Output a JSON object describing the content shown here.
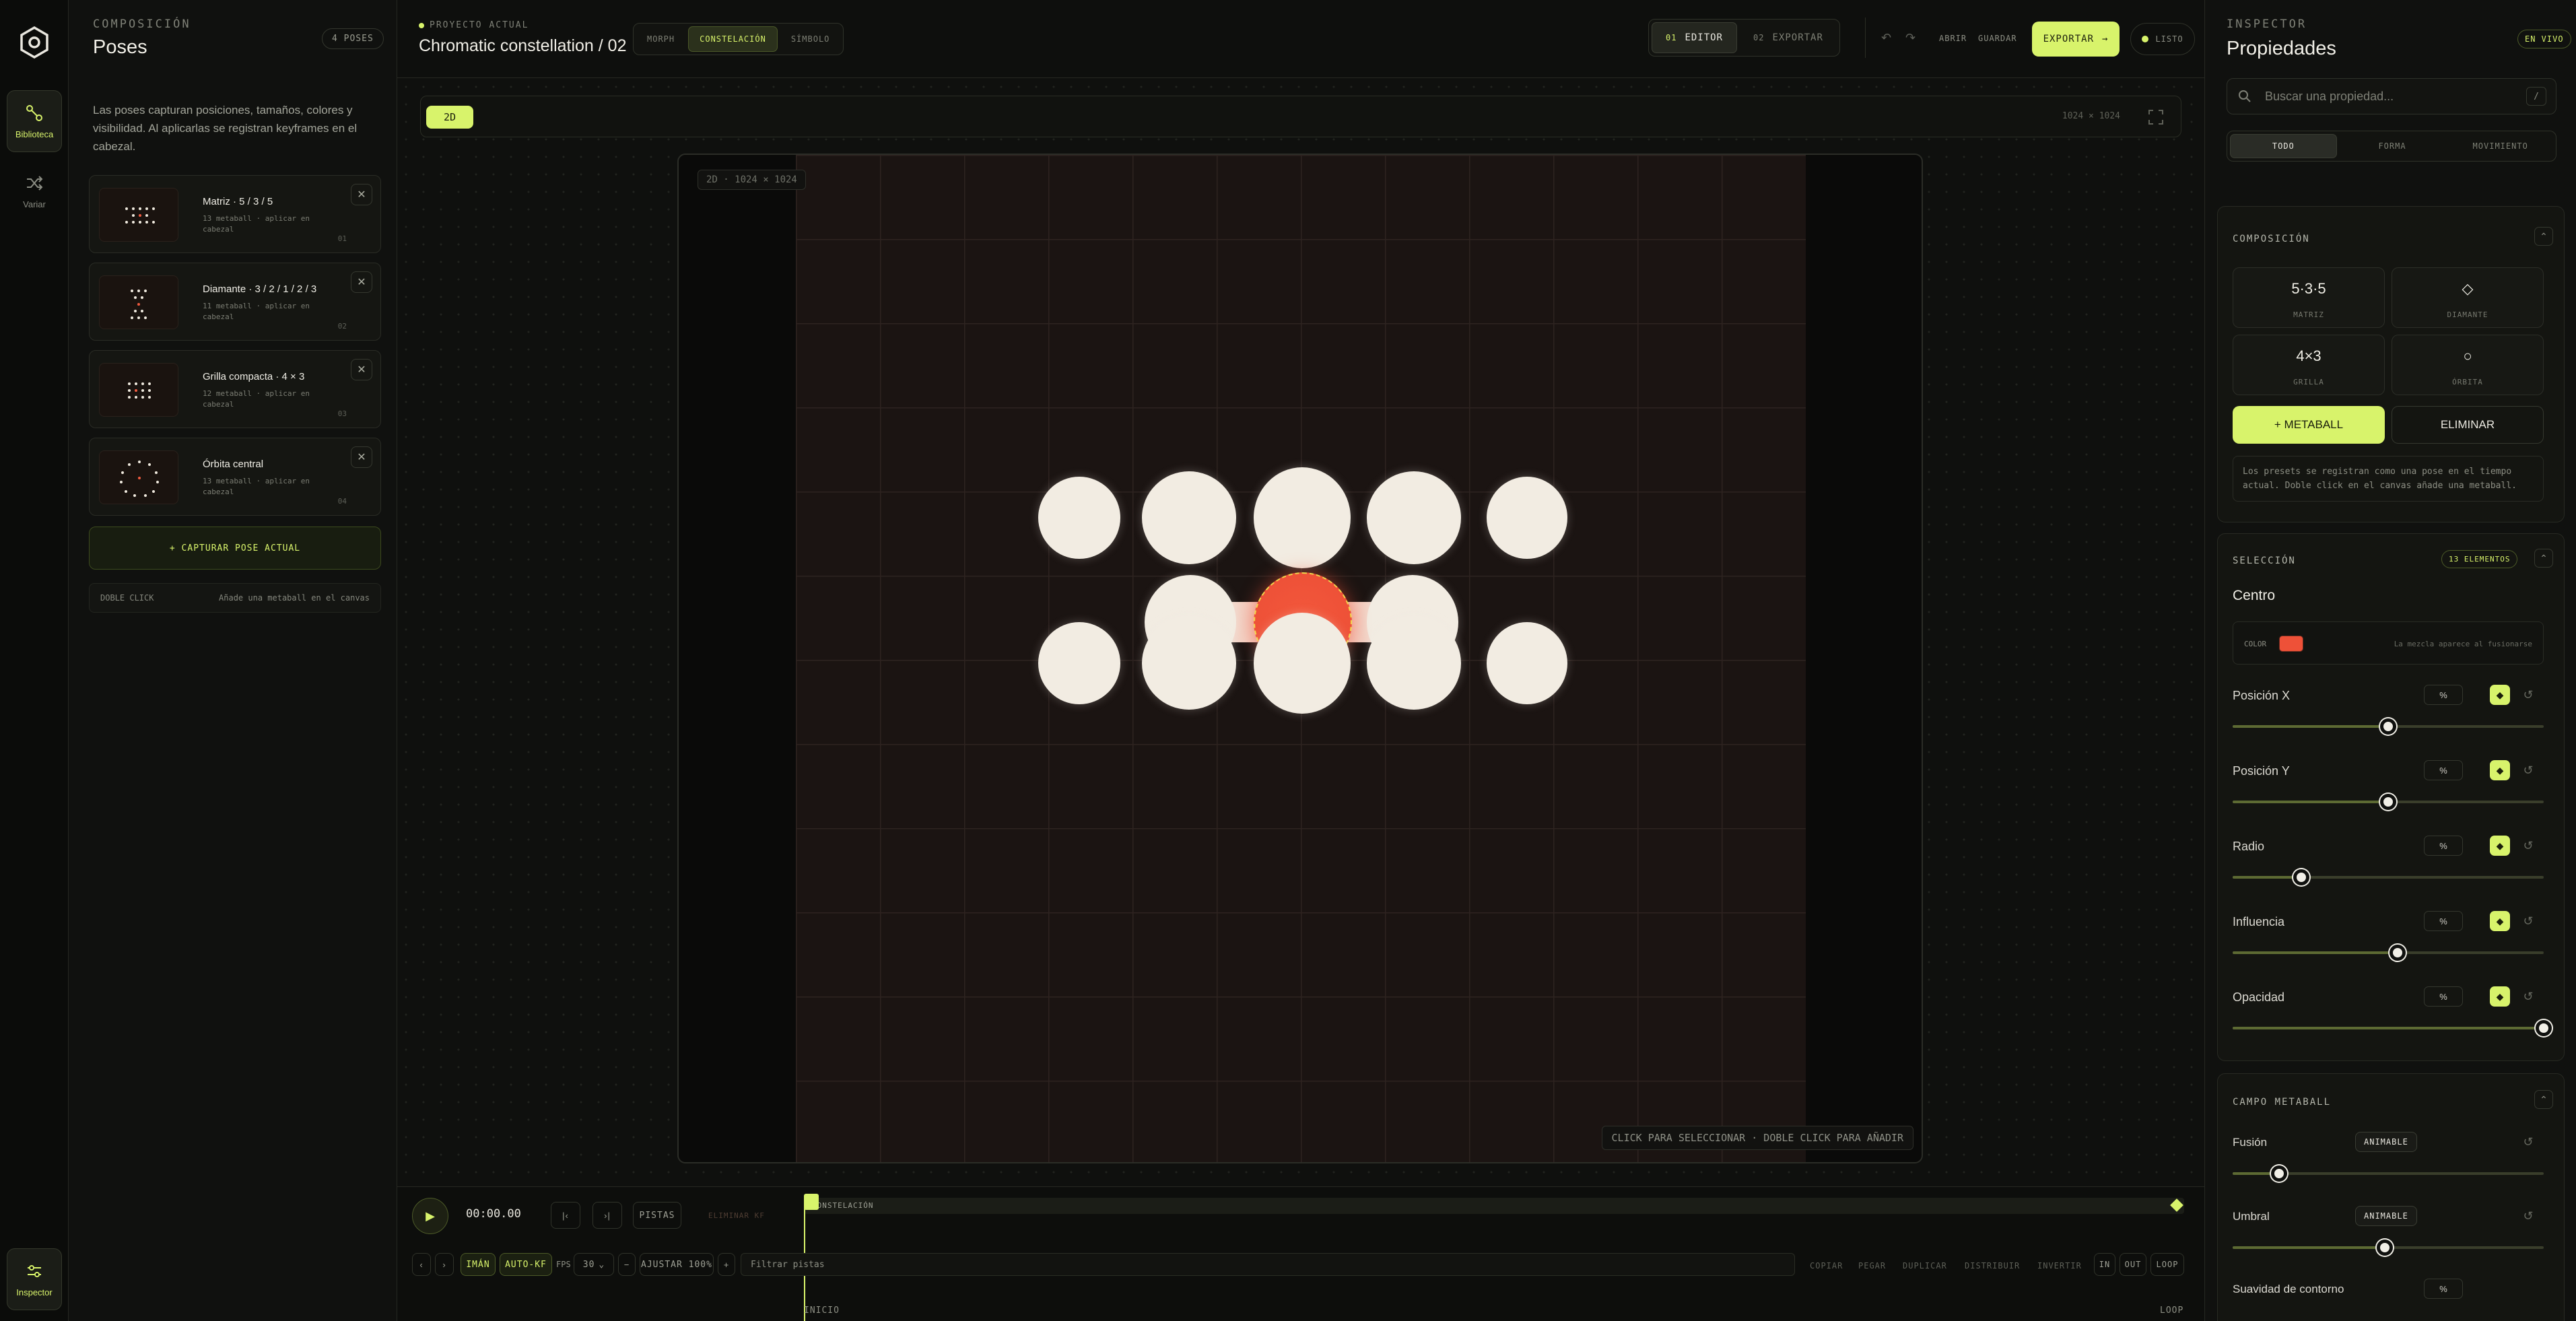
{
  "rail": {
    "library_label": "Biblioteca",
    "vary_label": "Variar",
    "inspector_label": "Inspector"
  },
  "poses_panel": {
    "eyebrow": "COMPOSICIÓN",
    "title": "Poses",
    "count": "4 POSES",
    "description": "Las poses capturan posiciones, tamaños, colores y visibilidad. Al aplicarlas se registran keyframes en el cabezal.",
    "items": [
      {
        "title": "Matriz · 5 / 3 / 5",
        "subtitle": "13 metaball · aplicar en cabezal",
        "num": "01"
      },
      {
        "title": "Diamante · 3 / 2 / 1 / 2 / 3",
        "subtitle": "11 metaball · aplicar en cabezal",
        "num": "02"
      },
      {
        "title": "Grilla compacta · 4 × 3",
        "subtitle": "12 metaball · aplicar en cabezal",
        "num": "03"
      },
      {
        "title": "Órbita central",
        "subtitle": "13 metaball · aplicar en cabezal",
        "num": "04"
      }
    ],
    "capture_label": "+ CAPTURAR POSE ACTUAL",
    "hint_key": "DOBLE CLICK",
    "hint_text": "Añade una metaball en el canvas"
  },
  "topbar": {
    "project_label": "PROYECTO ACTUAL",
    "project_title": "Chromatic constellation / 02",
    "modes": [
      "MORPH",
      "CONSTELACIÓN",
      "SÍMBOLO"
    ],
    "active_mode": "CONSTELACIÓN",
    "views": [
      {
        "num": "01",
        "label": "EDITOR"
      },
      {
        "num": "02",
        "label": "EXPORTAR"
      }
    ],
    "open_label": "ABRIR",
    "save_label": "GUARDAR",
    "export_label": "EXPORTAR",
    "status_label": "LISTO"
  },
  "stage": {
    "mode_badge": "2D",
    "resolution": "1024 × 1024",
    "frame_label": "2D · 1024 × 1024",
    "help": "CLICK PARA SELECCIONAR · DOBLE CLICK PARA AÑADIR"
  },
  "timeline": {
    "time": "00:00.00",
    "tracks_label": "PISTAS",
    "delete_kf_label": "ELIMINAR KF",
    "track_name": "CONSTELACIÓN",
    "magnet_label": "IMÁN",
    "autokf_label": "AUTO-KF",
    "fps_label": "FPS",
    "fps_value": "30",
    "fit_label": "AJUSTAR 100%",
    "filter_placeholder": "Filtrar pistas",
    "actions": [
      "COPIAR",
      "PEGAR",
      "DUPLICAR",
      "DISTRIBUIR",
      "INVERTIR"
    ],
    "in_label": "IN",
    "out_label": "OUT",
    "loop_label": "LOOP",
    "start_label": "INICIO",
    "end_label": "LOOP"
  },
  "inspector": {
    "eyebrow": "INSPECTOR",
    "title": "Propiedades",
    "live_label": "EN VIVO",
    "search_placeholder": "Buscar una propiedad...",
    "search_key": "/",
    "tabs": [
      "TODO",
      "FORMA",
      "MOVIMIENTO"
    ],
    "composition": {
      "title": "COMPOSICIÓN",
      "presets": [
        {
          "value": "5·3·5",
          "label": "MATRIZ"
        },
        {
          "value": "◇",
          "label": "DIAMANTE"
        },
        {
          "value": "4×3",
          "label": "GRILLA"
        },
        {
          "value": "○",
          "label": "ÓRBITA"
        }
      ],
      "add_label": "+ METABALL",
      "delete_label": "ELIMINAR",
      "note": "Los presets se registran como una pose en el tiempo actual. Doble click en el canvas añade una metaball."
    },
    "selection": {
      "title": "SELECCIÓN",
      "count": "13 ELEMENTOS",
      "name": "Centro",
      "color_label": "COLOR",
      "color_value": "#ee5138",
      "color_note": "La mezcla aparece al fusionarse",
      "props": [
        {
          "label": "Posición X",
          "unit": "%",
          "value": 0.5
        },
        {
          "label": "Posición Y",
          "unit": "%",
          "value": 0.5
        },
        {
          "label": "Radio",
          "unit": "%",
          "value": 0.22
        },
        {
          "label": "Influencia",
          "unit": "%",
          "value": 0.53
        },
        {
          "label": "Opacidad",
          "unit": "%",
          "value": 1.0
        }
      ]
    },
    "field": {
      "title": "CAMPO METABALL",
      "props": [
        {
          "label": "Fusión",
          "badge": "ANIMABLE",
          "value": 0.15
        },
        {
          "label": "Umbral",
          "badge": "ANIMABLE",
          "value": 0.49
        }
      ],
      "smooth_label": "Suavidad de contorno",
      "smooth_unit": "%"
    }
  },
  "colors": {
    "accent": "#d8f36b",
    "selected_ball": "#ee5138",
    "ball": "#f2ece2"
  }
}
